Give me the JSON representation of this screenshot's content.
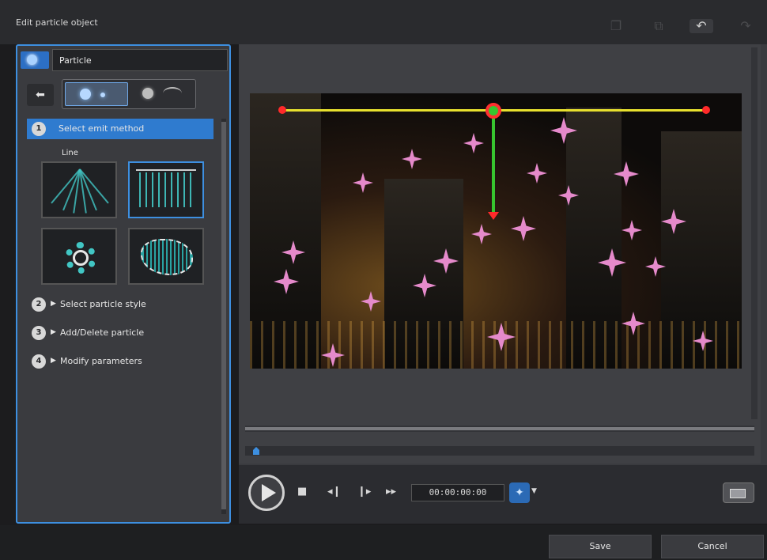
{
  "window": {
    "title": "Edit particle object"
  },
  "toolbar": {
    "icons": [
      "copy-icon",
      "paste-icon",
      "undo-icon",
      "redo-icon"
    ]
  },
  "particle": {
    "name": "Particle"
  },
  "steps": [
    {
      "number": "1",
      "label": "Select emit method"
    },
    {
      "number": "2",
      "label": "Select particle style"
    },
    {
      "number": "3",
      "label": "Add/Delete particle"
    },
    {
      "number": "4",
      "label": "Modify parameters"
    }
  ],
  "emit": {
    "selected_label": "Line",
    "options": [
      "point-spread",
      "line",
      "radial-burst",
      "shape-area"
    ]
  },
  "playback": {
    "timecode": "00:00:00:00"
  },
  "footer": {
    "save_label": "Save",
    "cancel_label": "Cancel"
  },
  "colors": {
    "accent": "#3d8fe0",
    "path_line": "#e7e02e",
    "direction_line": "#37c62f",
    "particle": "#e58acb"
  }
}
